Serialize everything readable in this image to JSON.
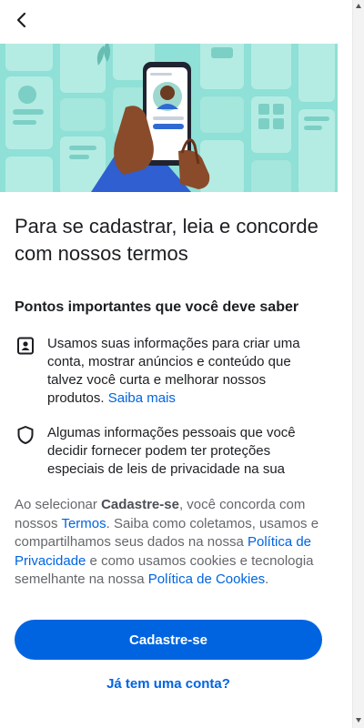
{
  "header": {
    "back_icon": "chevron-left-icon"
  },
  "hero": {
    "description": ""
  },
  "title": "Para se cadastrar, leia e concorde com nossos termos",
  "subtitle": "Pontos importantes que você deve saber",
  "items": [
    {
      "icon": "id-card-icon",
      "text": "Usamos suas informações para criar uma conta, mostrar anúncios e conteúdo que talvez você curta e melhorar nossos produtos.",
      "link": "Saiba mais"
    },
    {
      "icon": "shield-icon",
      "text": "Algumas informações pessoais que você decidir fornecer podem ter proteções especiais de leis de privacidade na sua"
    }
  ],
  "consent": {
    "prefix": "Ao selecionar ",
    "bold": "Cadastre-se",
    "mid1": ", você concorda com nossos ",
    "terms_link": "Termos",
    "mid2": ". Saiba como coletamos, usamos e compartilhamos seus dados na nossa ",
    "privacy_link": "Política de Privacidade",
    "mid3": " e como usamos cookies e tecnologia semelhante na nossa ",
    "cookies_link": "Política de Cookies",
    "suffix": "."
  },
  "buttons": {
    "signup": "Cadastre-se",
    "have_account": "Já tem uma conta?"
  },
  "colors": {
    "primary": "#0064e0",
    "text": "#1c1e21",
    "muted": "#65676b",
    "hero_bg": "#8fe0d6"
  }
}
